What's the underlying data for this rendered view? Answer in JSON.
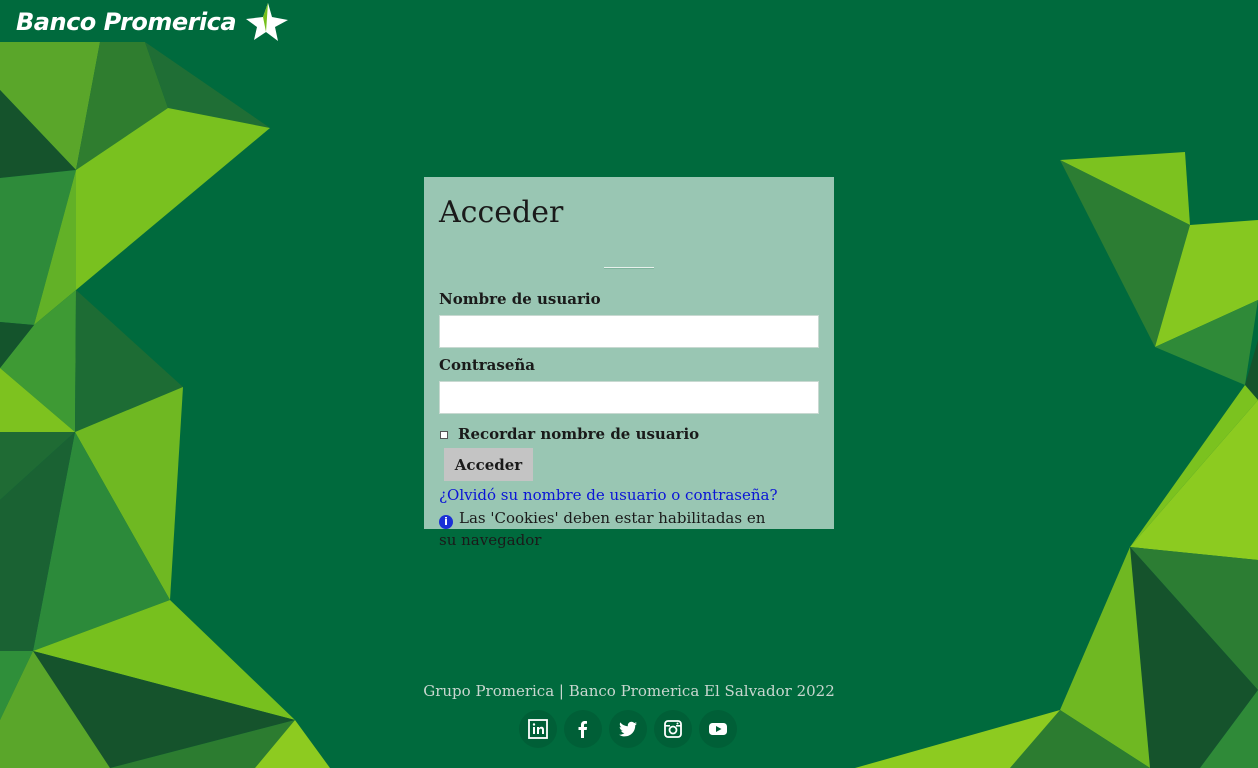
{
  "header": {
    "brand_name": "Banco Promerica"
  },
  "login": {
    "title": "Acceder",
    "username_label": "Nombre de usuario",
    "username_value": "",
    "password_label": "Contraseña",
    "password_value": "",
    "remember_label": "Recordar nombre de usuario",
    "remember_checked": false,
    "submit_label": "Acceder",
    "forgot_link": "¿Olvidó su nombre de usuario o contraseña?",
    "cookies_note": "Las 'Cookies' deben estar habilitadas en su navegador"
  },
  "footer": {
    "copyright": "Grupo Promerica | Banco Promerica El Salvador 2022",
    "social": [
      {
        "icon": "linkedin-icon"
      },
      {
        "icon": "facebook-icon"
      },
      {
        "icon": "twitter-icon"
      },
      {
        "icon": "instagram-icon"
      },
      {
        "icon": "youtube-icon"
      }
    ]
  },
  "colors": {
    "background": "#006a3d",
    "card": "#99c6b3",
    "link": "#0a14d6",
    "accent_green": "#76c01d"
  }
}
